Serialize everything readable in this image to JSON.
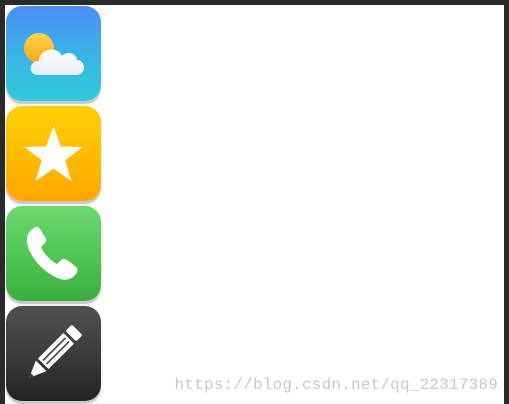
{
  "apps": [
    {
      "id": "weather",
      "icon": "weather-cloud-sun-icon",
      "gradient": [
        "#4a8ef5",
        "#2fcbd8"
      ]
    },
    {
      "id": "favorites",
      "icon": "star-icon",
      "gradient": [
        "#ffd106",
        "#ffa600"
      ]
    },
    {
      "id": "phone",
      "icon": "phone-handset-icon",
      "gradient": [
        "#6bd96f",
        "#3aae3e"
      ]
    },
    {
      "id": "notes",
      "icon": "pencil-icon",
      "gradient": [
        "#505050",
        "#232323"
      ]
    }
  ],
  "watermark": {
    "text": "https://blog.csdn.net/qq_22317389"
  },
  "colors": {
    "frame": "#2a2a2a",
    "background": "#ffffff"
  }
}
